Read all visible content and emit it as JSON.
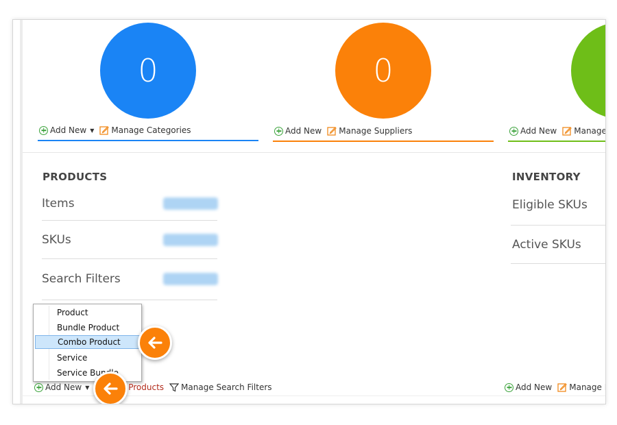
{
  "tiles": [
    {
      "value": "0",
      "color": "#1a84f5",
      "add_label": "Add New",
      "manage_label": "Manage Categories"
    },
    {
      "value": "0",
      "color": "#fb8109",
      "add_label": "Add New",
      "manage_label": "Manage Suppliers"
    },
    {
      "value": "",
      "color": "#6ebe18",
      "add_label": "Add New",
      "manage_label": "Manage"
    }
  ],
  "products": {
    "title": "PRODUCTS",
    "rows": [
      "Items",
      "SKUs",
      "Search Filters"
    ],
    "add_label": "Add New",
    "manage_products_label": "ge Products",
    "manage_filters_label": "Manage Search Filters"
  },
  "inventory": {
    "title": "INVENTORY",
    "rows": [
      "Eligible SKUs",
      "Active SKUs"
    ],
    "add_label": "Add New",
    "manage_label": "Manage In"
  },
  "add_menu": {
    "items": [
      "Product",
      "Bundle Product",
      "Combo Product",
      "Service",
      "Service Bundle"
    ],
    "highlighted": "Combo Product"
  },
  "colors": {
    "accent_orange": "#fb8109",
    "accent_blue": "#1a84f5",
    "accent_green": "#6ebe18",
    "link_red": "#b22b1b"
  }
}
